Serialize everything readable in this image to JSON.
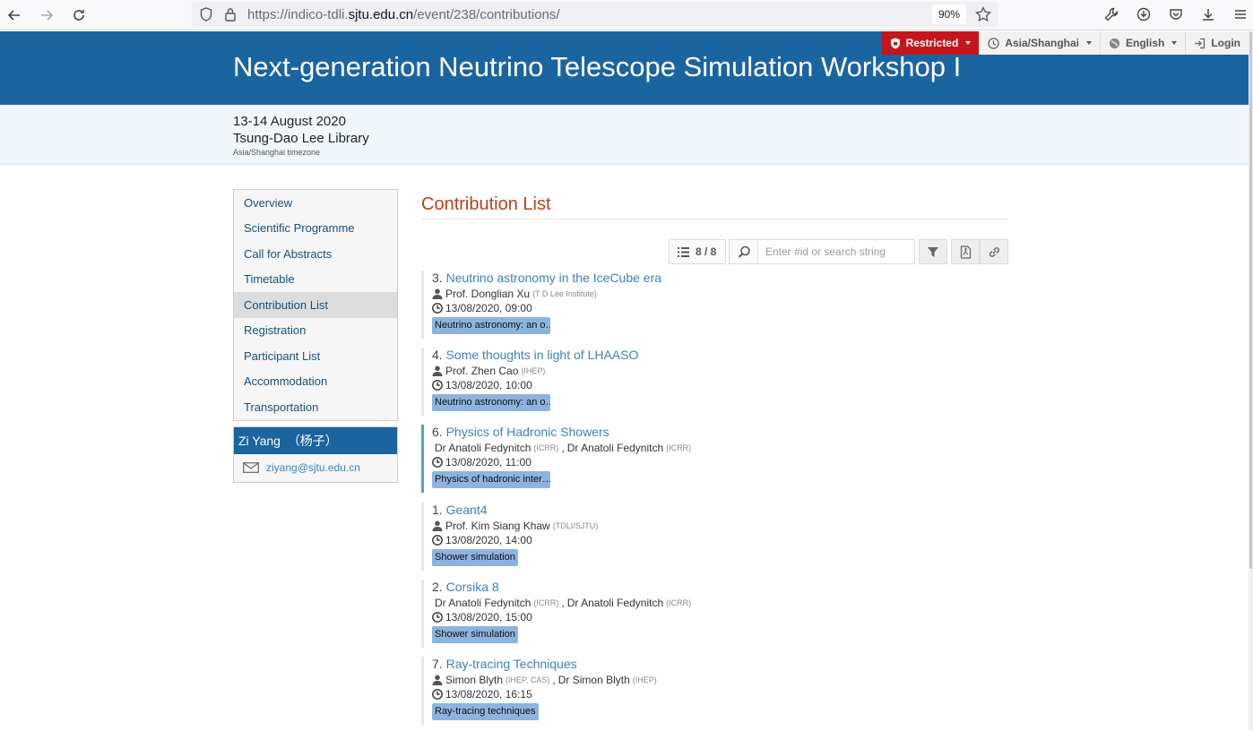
{
  "browser": {
    "url_prefix": "https://indico-tdli.",
    "url_domain": "sjtu.edu.cn",
    "url_path": "/event/238/contributions/",
    "zoom": "90%"
  },
  "top_menu": {
    "restricted": "Restricted",
    "timezone": "Asia/Shanghai",
    "language": "English",
    "login": "Login"
  },
  "event": {
    "title": "Next-generation Neutrino Telescope Simulation Workshop I",
    "dates": "13-14 August 2020",
    "venue": "Tsung-Dao Lee Library",
    "timezone_note": "Asia/Shanghai timezone"
  },
  "sidebar": {
    "items": [
      {
        "label": "Overview"
      },
      {
        "label": "Scientific Programme"
      },
      {
        "label": "Call for Abstracts"
      },
      {
        "label": "Timetable"
      },
      {
        "label": "Contribution List"
      },
      {
        "label": "Registration"
      },
      {
        "label": "Participant List"
      },
      {
        "label": "Accommodation"
      },
      {
        "label": "Transportation"
      }
    ],
    "active_index": 4,
    "contact_name": "Zi Yang  （杨子）",
    "contact_email": "ziyang@sjtu.edu.cn"
  },
  "main": {
    "page_title": "Contribution List",
    "counter": "8 / 8",
    "search_placeholder": "Enter #id or search string"
  },
  "contributions": [
    {
      "num": "3.",
      "title": "Neutrino astronomy in the IceCube era",
      "speakers": [
        {
          "name": "Prof. Donglian Xu",
          "aff": "(T D Lee Institute)"
        }
      ],
      "time": "13/08/2020, 09:00",
      "tag": "Neutrino astronomy: an o…",
      "highlight": false
    },
    {
      "num": "4.",
      "title": "Some thoughts in light of LHAASO",
      "speakers": [
        {
          "name": "Prof. Zhen Cao",
          "aff": "(IHEP)"
        }
      ],
      "time": "13/08/2020, 10:00",
      "tag": "Neutrino astronomy: an o…",
      "highlight": false
    },
    {
      "num": "6.",
      "title": "Physics of Hadronic Showers",
      "speakers": [
        {
          "name": "Dr Anatoli Fedynitch",
          "aff": "(ICRR)"
        },
        {
          "name": "Dr Anatoli Fedynitch",
          "aff": "(ICRR)"
        }
      ],
      "time": "13/08/2020, 11:00",
      "tag": "Physics of hadronic inter…",
      "highlight": true
    },
    {
      "num": "1.",
      "title": "Geant4",
      "speakers": [
        {
          "name": "Prof. Kim Siang Khaw",
          "aff": "(TDLI/SJTU)"
        }
      ],
      "time": "13/08/2020, 14:00",
      "tag": "Shower simulation",
      "highlight": false
    },
    {
      "num": "2.",
      "title": "Corsika 8",
      "speakers": [
        {
          "name": "Dr Anatoli Fedynitch",
          "aff": "(ICRR)"
        },
        {
          "name": "Dr Anatoli Fedynitch",
          "aff": "(ICRR)"
        }
      ],
      "time": "13/08/2020, 15:00",
      "tag": "Shower simulation",
      "highlight": false
    },
    {
      "num": "7.",
      "title": "Ray-tracing Techniques",
      "speakers": [
        {
          "name": "Simon Blyth",
          "aff": "(IHEP, CAS)"
        },
        {
          "name": "Dr Simon Blyth",
          "aff": "(IHEP)"
        }
      ],
      "time": "13/08/2020, 16:15",
      "tag": "Ray-tracing techniques",
      "highlight": false
    }
  ],
  "colors": {
    "header": "#1a64a0",
    "restricted": "#c4161c",
    "link": "#3d80c0",
    "page_title": "#b8401a",
    "tag": "#8db4df"
  }
}
